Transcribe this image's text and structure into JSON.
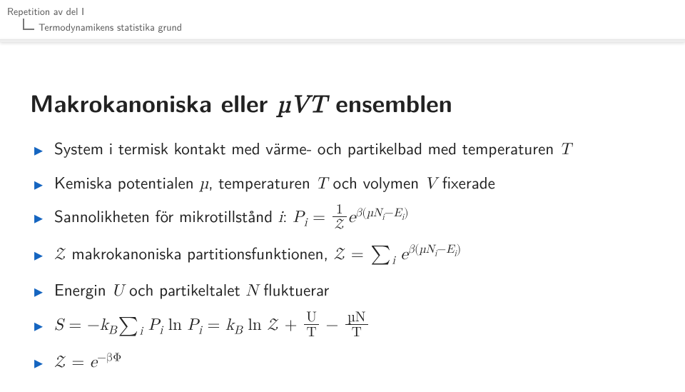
{
  "breadcrumb": {
    "level1": "Repetition av del I",
    "level2": "Termodynamikens statistika grund"
  },
  "title_prefix": "Makrokanoniska eller ",
  "title_math": "µVT",
  "title_suffix": " ensemblen",
  "bullets": {
    "b1_pre": "System i termisk kontakt med värme- och partikelbad med temperaturen ",
    "b1_T": "T",
    "b2_pre": "Kemiska potentialen ",
    "b2_mu": "µ",
    "b2_mid": ", temperaturen ",
    "b2_T": "T",
    "b2_mid2": " och volymen ",
    "b2_V": "V",
    "b2_suf": " fixerade",
    "b3_pre": "Sannolikheten för mikrotillstånd ",
    "b3_i": "i",
    "b3_colon": ": ",
    "b3_Pi": "P",
    "b3_Pi_sub": "i",
    "b3_eq": " = ",
    "b3_fr_num": "1",
    "b3_fr_den": "𝒵",
    "b3_e": "e",
    "b3_exp_beta": "β",
    "b3_exp_open": "(",
    "b3_exp_mu": "µN",
    "b3_exp_Nsub": "i",
    "b3_exp_minus": "−",
    "b3_exp_E": "E",
    "b3_exp_Esub": "i",
    "b3_exp_close": ")",
    "b4_Z": "𝒵",
    "b4_text": " makrokanoniska partitionsfunktionen, ",
    "b4_Z2": "𝒵",
    "b4_eq": " = ",
    "b4_sum": "∑",
    "b4_sumidx": "i",
    "b4_e": " e",
    "b4_exp_beta": "β",
    "b4_exp_open": "(",
    "b4_exp_mu": "µN",
    "b4_exp_Nsub": "i",
    "b4_exp_minus": "−",
    "b4_exp_E": "E",
    "b4_exp_Esub": "i",
    "b4_exp_close": ")",
    "b5_pre": "Energin ",
    "b5_U": "U",
    "b5_mid": " och partikeltalet ",
    "b5_N": "N",
    "b5_suf": " fluktuerar",
    "b6_S": "S",
    "b6_eq": " = −",
    "b6_kB_k": "k",
    "b6_kB_B": "B",
    "b6_sum": " ∑",
    "b6_sumidx": "i",
    "b6_Pi1": " P",
    "b6_Pi1_sub": "i",
    "b6_ln1": " ln ",
    "b6_Pi2": "P",
    "b6_Pi2_sub": "i",
    "b6_eq2": " = ",
    "b6_kB2_k": "k",
    "b6_kB2_B": "B",
    "b6_ln2": " ln ",
    "b6_Z": "𝒵",
    "b6_plus": " + ",
    "b6_fr1_num": "U",
    "b6_fr1_den": "T",
    "b6_minus": " − ",
    "b6_fr2_num": "µN",
    "b6_fr2_den": "T",
    "b7_Z": "𝒵",
    "b7_eq": " = ",
    "b7_e": "e",
    "b7_exp": "−βΦ"
  }
}
